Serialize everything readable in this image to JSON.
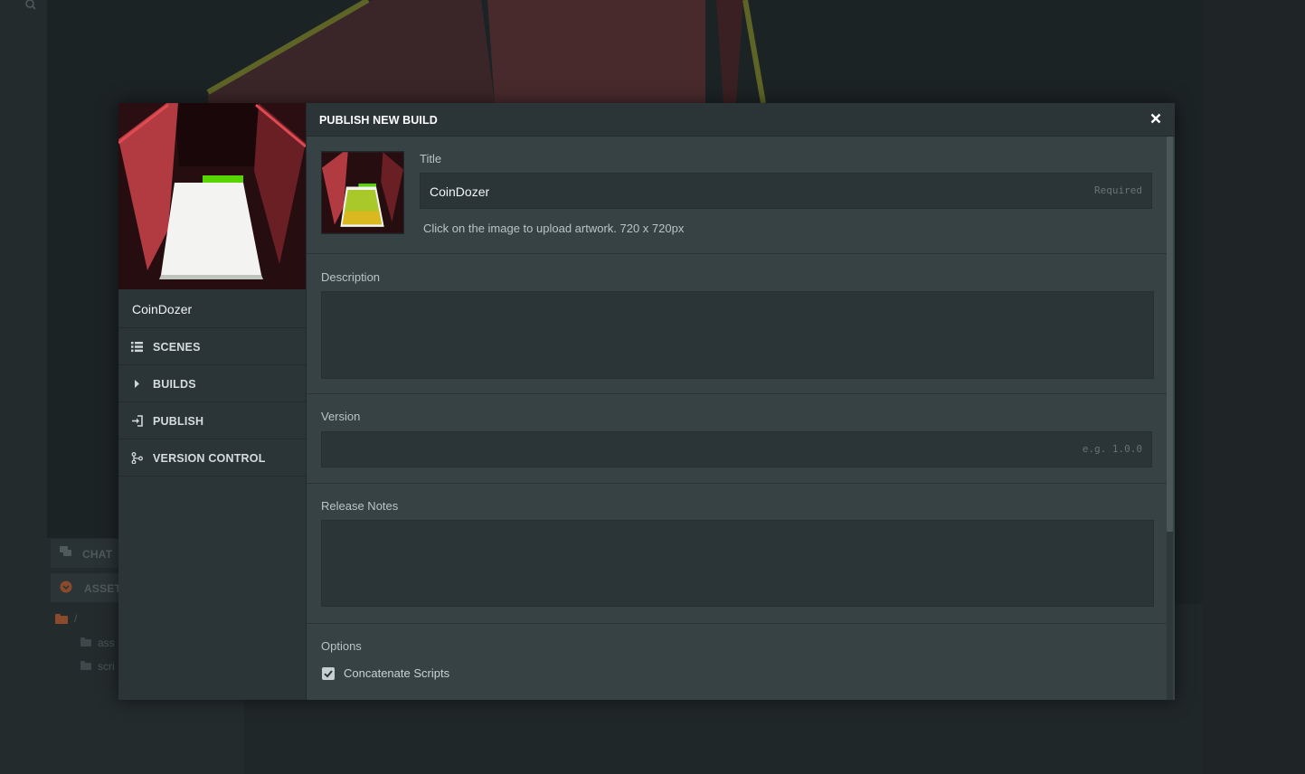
{
  "background": {
    "chat_tab_label": "CHAT",
    "assets_tab_label": "ASSET",
    "root_folder_label": "/",
    "folders": [
      "ass",
      "scri"
    ]
  },
  "sidebar": {
    "project_name": "CoinDozer",
    "items": [
      {
        "label": "SCENES",
        "icon": "list-icon"
      },
      {
        "label": "BUILDS",
        "icon": "caret-right-icon"
      },
      {
        "label": "PUBLISH",
        "icon": "publish-icon"
      },
      {
        "label": "VERSION CONTROL",
        "icon": "branch-icon"
      }
    ]
  },
  "dialog": {
    "title": "PUBLISH NEW BUILD",
    "title_field": {
      "label": "Title",
      "value": "CoinDozer",
      "placeholder": "Required",
      "hint": "Click on the image to upload artwork. 720 x 720px"
    },
    "description_field": {
      "label": "Description",
      "value": ""
    },
    "version_field": {
      "label": "Version",
      "value": "",
      "placeholder": "e.g. 1.0.0"
    },
    "release_notes_field": {
      "label": "Release Notes",
      "value": ""
    },
    "options": {
      "label": "Options",
      "concatenate_scripts": {
        "label": "Concatenate Scripts",
        "checked": true
      }
    }
  },
  "colors": {
    "dialog_bg": "#364244",
    "header_bg": "#2b3436",
    "input_bg": "#2b3537",
    "wall_red": "#b23b42",
    "coin_green": "#8cc21f",
    "coin_yellow": "#e0b81c",
    "bar_green": "#58d400"
  }
}
